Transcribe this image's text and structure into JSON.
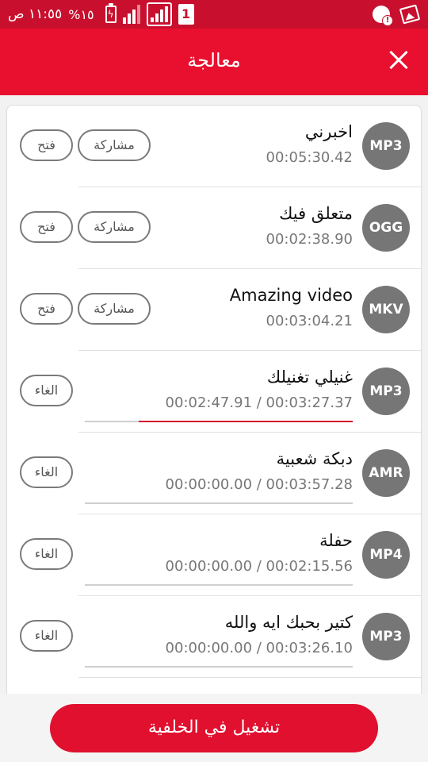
{
  "status_bar": {
    "time": "١١:٥٥ ص",
    "battery": "%١٥",
    "sim_slot": "1"
  },
  "header": {
    "title": "معالجة",
    "close_icon": "close-icon"
  },
  "items": [
    {
      "format": "MP3",
      "title": "اخبرني",
      "duration": "00:05:30.42",
      "state": "done",
      "share_label": "مشاركة",
      "open_label": "فتح"
    },
    {
      "format": "OGG",
      "title": "متعلق فيك",
      "duration": "00:02:38.90",
      "state": "done",
      "share_label": "مشاركة",
      "open_label": "فتح"
    },
    {
      "format": "MKV",
      "title": "Amazing video",
      "duration": "00:03:04.21",
      "state": "done",
      "share_label": "مشاركة",
      "open_label": "فتح"
    },
    {
      "format": "MP3",
      "title": "غنيلي تغنيلك",
      "duration": "00:02:47.91 / 00:03:27.37",
      "state": "processing",
      "progress": 0.8,
      "cancel_label": "الغاء"
    },
    {
      "format": "AMR",
      "title": "دبكة شعبية",
      "duration": "00:00:00.00 / 00:03:57.28",
      "state": "queued",
      "progress": 0,
      "cancel_label": "الغاء"
    },
    {
      "format": "MP4",
      "title": "حفلة",
      "duration": "00:00:00.00 / 00:02:15.56",
      "state": "queued",
      "progress": 0,
      "cancel_label": "الغاء"
    },
    {
      "format": "MP3",
      "title": "كتير بحبك ايه والله",
      "duration": "00:00:00.00 / 00:03:26.10",
      "state": "queued",
      "progress": 0,
      "cancel_label": "الغاء"
    }
  ],
  "footer": {
    "play_background_label": "تشغيل في الخلفية"
  },
  "colors": {
    "accent": "#e8102e",
    "status_bar": "#c8102e",
    "avatar": "#767676",
    "progress": "#d0102e"
  }
}
